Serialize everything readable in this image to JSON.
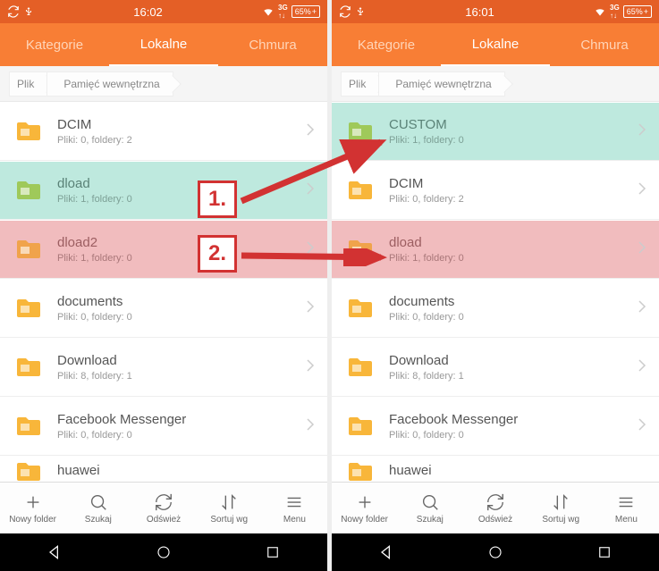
{
  "annotations": {
    "mark1": "1.",
    "mark2": "2."
  },
  "left": {
    "status": {
      "time": "16:02",
      "battery": "65%"
    },
    "tabs": {
      "cat": "Kategorie",
      "local": "Lokalne",
      "cloud": "Chmura"
    },
    "breadcrumb": {
      "root": "Plik",
      "path1": "Pamięć wewnętrzna"
    },
    "items": [
      {
        "name": "DCIM",
        "meta": "Pliki: 0, foldery: 2",
        "hl": ""
      },
      {
        "name": "dload",
        "meta": "Pliki: 1, foldery: 0",
        "hl": "teal"
      },
      {
        "name": "dload2",
        "meta": "Pliki: 1, foldery: 0",
        "hl": "red"
      },
      {
        "name": "documents",
        "meta": "Pliki: 0, foldery: 0",
        "hl": ""
      },
      {
        "name": "Download",
        "meta": "Pliki: 8, foldery: 1",
        "hl": ""
      },
      {
        "name": "Facebook Messenger",
        "meta": "Pliki: 0, foldery: 0",
        "hl": ""
      },
      {
        "name": "huawei",
        "meta": "",
        "hl": "",
        "peek": true
      }
    ],
    "bottom": {
      "new": "Nowy folder",
      "search": "Szukaj",
      "refresh": "Odśwież",
      "sort": "Sortuj wg",
      "menu": "Menu"
    }
  },
  "right": {
    "status": {
      "time": "16:01",
      "battery": "65%"
    },
    "tabs": {
      "cat": "Kategorie",
      "local": "Lokalne",
      "cloud": "Chmura"
    },
    "breadcrumb": {
      "root": "Plik",
      "path1": "Pamięć wewnętrzna"
    },
    "items": [
      {
        "name": "CUSTOM",
        "meta": "Pliki: 1, foldery: 0",
        "hl": "teal"
      },
      {
        "name": "DCIM",
        "meta": "Pliki: 0, foldery: 2",
        "hl": ""
      },
      {
        "name": "dload",
        "meta": "Pliki: 1, foldery: 0",
        "hl": "red"
      },
      {
        "name": "documents",
        "meta": "Pliki: 0, foldery: 0",
        "hl": ""
      },
      {
        "name": "Download",
        "meta": "Pliki: 8, foldery: 1",
        "hl": ""
      },
      {
        "name": "Facebook Messenger",
        "meta": "Pliki: 0, foldery: 0",
        "hl": ""
      },
      {
        "name": "huawei",
        "meta": "",
        "hl": "",
        "peek": true
      }
    ],
    "bottom": {
      "new": "Nowy folder",
      "search": "Szukaj",
      "refresh": "Odśwież",
      "sort": "Sortuj wg",
      "menu": "Menu"
    }
  }
}
